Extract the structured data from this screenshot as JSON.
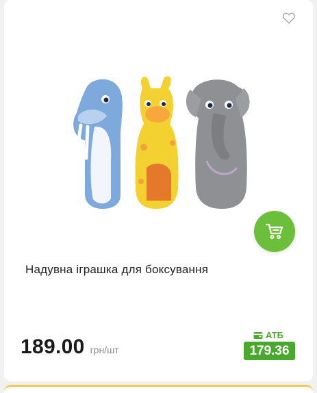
{
  "product": {
    "title": "Надувна іграшка для боксування",
    "price": "189.00",
    "unit": "грн/шт",
    "atb_label": "АТБ",
    "atb_price": "179.36"
  },
  "icons": {
    "favorite": "heart-outline-icon",
    "cart": "cart-icon",
    "card": "wallet-card-icon"
  },
  "colors": {
    "accent_green": "#6cbf3a",
    "atb_green": "#4aa82e",
    "divider_yellow": "#f2c94c"
  }
}
